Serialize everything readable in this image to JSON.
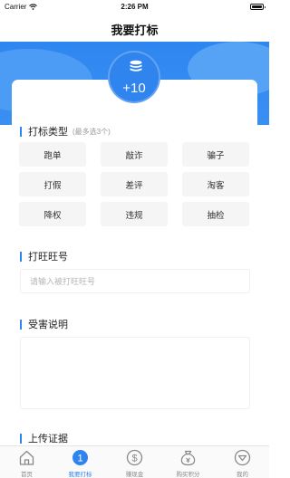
{
  "status_bar": {
    "carrier": "Carrier",
    "time": "2:26 PM"
  },
  "nav": {
    "title": "我要打标"
  },
  "reward": {
    "value": "+10"
  },
  "section_type": {
    "title": "打标类型",
    "hint": "(最多选3个)",
    "tags": [
      "跑单",
      "敲诈",
      "骗子",
      "打假",
      "差评",
      "淘客",
      "降权",
      "违规",
      "抽检"
    ]
  },
  "section_wangwang": {
    "title": "打旺旺号",
    "placeholder": "请输入被打旺旺号"
  },
  "section_victim": {
    "title": "受害说明"
  },
  "section_upload": {
    "title": "上传证据"
  },
  "tab_bar": {
    "items": [
      {
        "label": "首页",
        "icon": "home-icon"
      },
      {
        "label": "我要打标",
        "icon": "tag-one-icon",
        "badge": "1"
      },
      {
        "label": "赚现金",
        "icon": "dollar-icon"
      },
      {
        "label": "购买积分",
        "icon": "money-bag-icon"
      },
      {
        "label": "我的",
        "icon": "profile-icon"
      }
    ],
    "active_index": 1
  },
  "colors": {
    "primary": "#2f84ee",
    "tag_bg": "#f5f5f5"
  }
}
